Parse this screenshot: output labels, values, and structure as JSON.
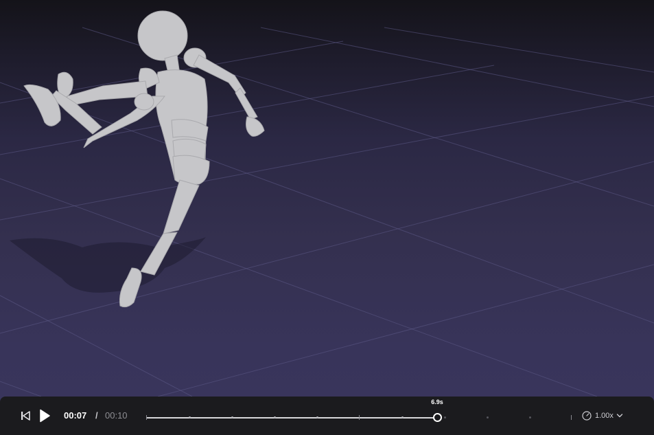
{
  "player": {
    "current_time": "00:07",
    "separator": "/",
    "total_time": "00:10",
    "scrub_label": "6.9s",
    "progress_fraction": 0.69,
    "speed_label": "1.00x"
  },
  "icons": {
    "skip_back": "skip-to-start-icon",
    "play": "play-icon",
    "speed": "speedometer-icon",
    "dropdown": "chevron-down-icon"
  },
  "colors": {
    "floor": "#38345a",
    "grid": "#5a5680",
    "figure": "#c9c9cc",
    "controls_bg": "#1b1b1e"
  }
}
